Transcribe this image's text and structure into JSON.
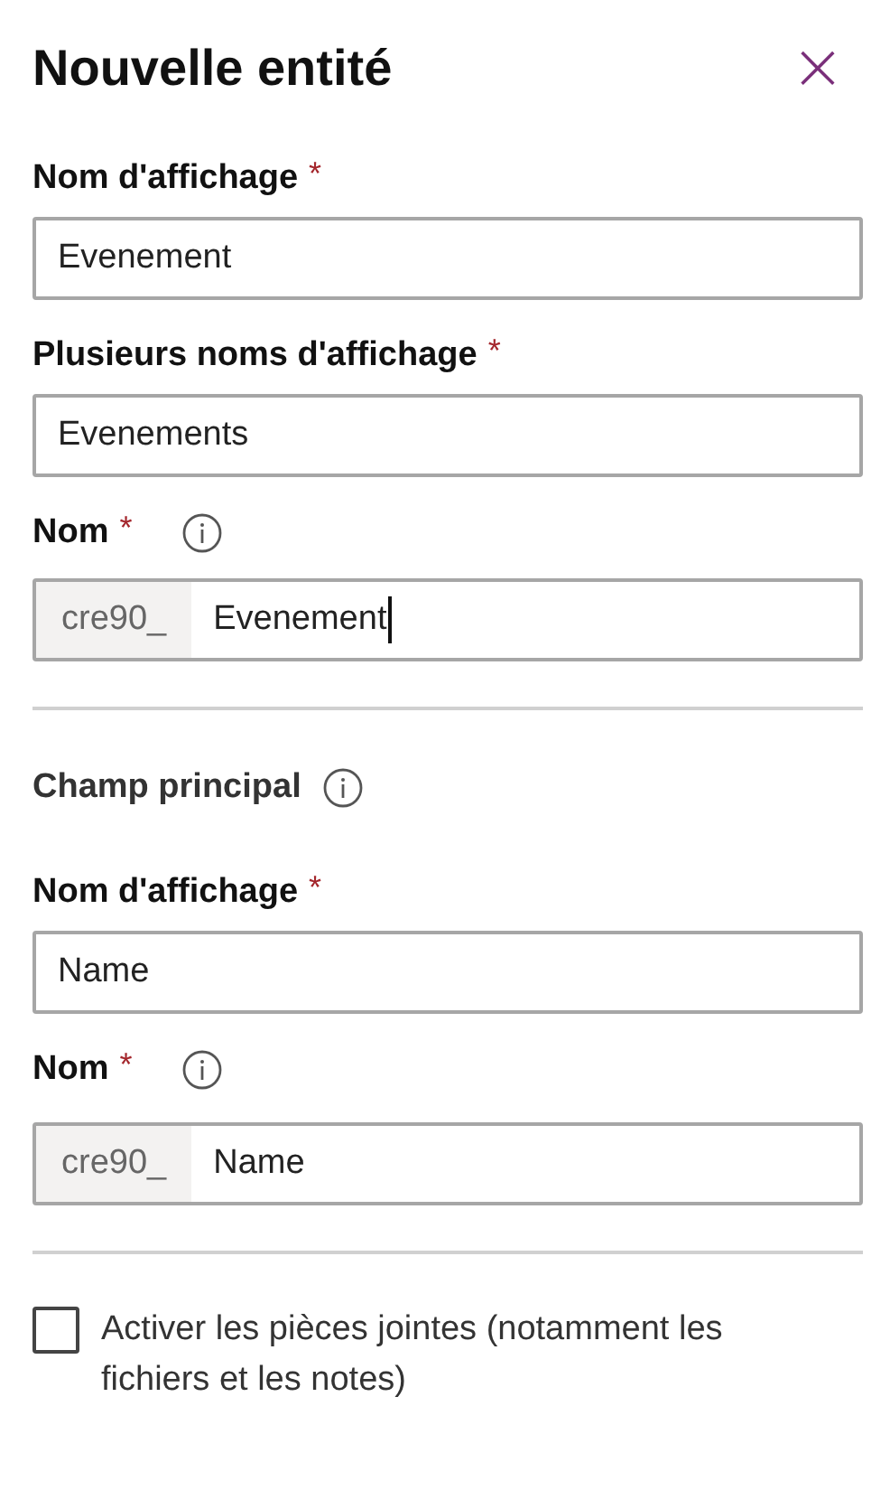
{
  "panel": {
    "title": "Nouvelle entité",
    "close_icon": "×"
  },
  "sections": [
    {
      "fields": [
        {
          "kind": "text",
          "label": "Nom d'affichage",
          "required_mark": "*",
          "info": false,
          "value": "Evenement",
          "focused": false
        },
        {
          "kind": "text",
          "label": "Plusieurs noms d'affichage",
          "required_mark": "*",
          "info": false,
          "value": "Evenements",
          "focused": false
        },
        {
          "kind": "prefixed",
          "label": "Nom",
          "required_mark": "*",
          "info": true,
          "prefix": "cre90_",
          "value": "Evenement",
          "focused": true
        }
      ]
    },
    {
      "heading": "Champ principal",
      "heading_info": true,
      "fields": [
        {
          "kind": "text",
          "label": "Nom d'affichage",
          "required_mark": "*",
          "info": false,
          "value": "Name",
          "focused": false
        },
        {
          "kind": "prefixed",
          "label": "Nom",
          "required_mark": "*",
          "info": true,
          "prefix": "cre90_",
          "value": "Name",
          "focused": false
        }
      ]
    }
  ],
  "checkbox": {
    "label": "Activer les pièces jointes (notamment les fichiers et les notes)",
    "checked": false
  }
}
